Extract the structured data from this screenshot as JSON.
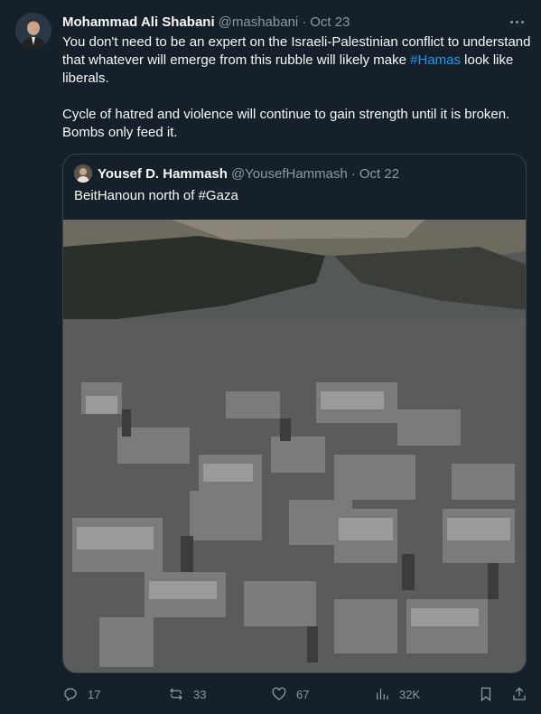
{
  "tweet": {
    "author_name": "Mohammad Ali Shabani",
    "handle": "@mashabani",
    "separator": "·",
    "date": "Oct 23",
    "text_line1_pre": "You don't need to be an expert on the Israeli-Palestinian conflict to understand that whatever will emerge from this rubble will likely make ",
    "hashtag": "#Hamas",
    "text_line1_post": " look like liberals.",
    "text_para2": "Cycle of hatred and violence will continue to gain strength until it is broken. Bombs only feed it."
  },
  "quoted": {
    "author_name": "Yousef D. Hammash",
    "handle": "@YousefHammash",
    "separator": "·",
    "date": "Oct 22",
    "text": "BeitHanoun north of #Gaza"
  },
  "actions": {
    "replies": "17",
    "retweets": "33",
    "likes": "67",
    "views": "32K"
  },
  "icons": [
    "more-icon",
    "reply-icon",
    "retweet-icon",
    "like-icon",
    "views-icon",
    "bookmark-icon",
    "share-icon"
  ],
  "colors": {
    "background": "#15202b",
    "text": "#f7f9f9",
    "secondary": "#8b98a5",
    "link": "#1d9bf0",
    "border": "#38444d"
  }
}
